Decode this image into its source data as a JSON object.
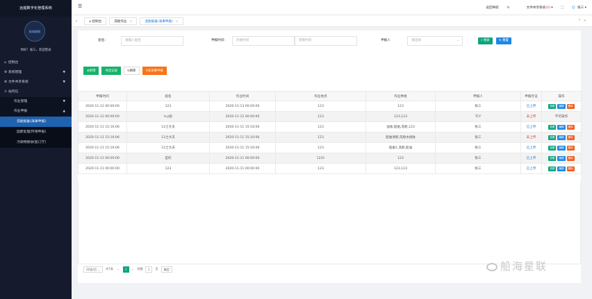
{
  "app": {
    "title": "远船数字化管理系统"
  },
  "sidebar": {
    "avatar_text": "船海星联",
    "greeting": "你好！张三，欢迎登录",
    "items": [
      {
        "label": "控制台",
        "icon": "home-icon"
      },
      {
        "label": "系统管理",
        "icon": "gears-icon"
      },
      {
        "label": "文件共享系统",
        "icon": "gear-icon"
      },
      {
        "label": "站内信",
        "icon": "user-icon"
      },
      {
        "label": "作业管理"
      },
      {
        "label": "作业申报"
      },
      {
        "label": "洗舱报备(海事申报)"
      },
      {
        "label": "固废处理(环保申报)"
      },
      {
        "label": "污染物接收(船订厅)"
      }
    ]
  },
  "topbar": {
    "back_nav": "返回导航",
    "file_share": "文件共享系统",
    "file_share_count": "(0)",
    "user": "张三"
  },
  "tabs": [
    {
      "label": "控制台"
    },
    {
      "label": "洗舱作业"
    },
    {
      "label": "洗舱报备(海事申报)"
    }
  ],
  "search": {
    "ship_label": "船名:",
    "ship_placeholder": "请输入船名",
    "date_label": "申报时间:",
    "start_placeholder": "开始时间",
    "end_placeholder": "结束时间",
    "applicant_label": "申报人",
    "applicant_placeholder": "请选择",
    "search_btn": "搜索",
    "reset_btn": "重置"
  },
  "toolbar": {
    "add": "新增",
    "export": "导出记录",
    "refresh": "刷新",
    "report": "去海事申报"
  },
  "table": {
    "headers": [
      "申报时间",
      "船名",
      "作业时间",
      "作业地点",
      "作业种类",
      "申报人",
      "申报凭证",
      "操作"
    ],
    "rows": [
      {
        "time": "2020-11-12 00:00:00",
        "ship": "123",
        "work_time": "2020-11-13 00:00:00",
        "place": "123",
        "kind": "123",
        "applicant": "张三",
        "status": "已上传",
        "status_type": "up",
        "ops": true
      },
      {
        "time": "2020-11-12 00:00:00",
        "ship": "tcy船",
        "work_time": "2020-11-12 00:00:00",
        "place": "123",
        "kind": "123,123",
        "applicant": "TCY",
        "status": "未上传",
        "status_type": "no",
        "ops": false,
        "ops_text": "不可操作"
      },
      {
        "time": "2020-11-11 15:16:06",
        "ship": "12士大夫",
        "work_time": "2020-11-11 15:16:06",
        "place": "123",
        "kind": "油收,船舶,洗舱,123",
        "applicant": "张三",
        "status": "已上传",
        "status_type": "up",
        "ops": true
      },
      {
        "time": "2020-11-11 15:16:06",
        "ship": "12士大夫",
        "work_time": "2020-11-11 15:16:06",
        "place": "123",
        "kind": "船舶清舱,洗舱水接收",
        "applicant": "张三",
        "status": "未上传",
        "status_type": "no",
        "ops": true
      },
      {
        "time": "2020-11-11 15:16:06",
        "ship": "12士大夫",
        "work_time": "2020-11-11 15:16:06",
        "place": "123",
        "kind": "船舶1,洗舱,船油",
        "applicant": "张三",
        "status": "已上传",
        "status_type": "up",
        "ops": true
      },
      {
        "time": "2020-11-11 00:00:00",
        "ship": "是的",
        "work_time": "2020-11-11 00:00:00",
        "place": "1231",
        "kind": "123",
        "applicant": "张三",
        "status": "已上传",
        "status_type": "up",
        "ops": true
      },
      {
        "time": "2020-11-11 00:00:00",
        "ship": "123",
        "work_time": "2020-11-11 00:00:00",
        "place": "123",
        "kind": "123,123",
        "applicant": "张三",
        "status": "已上传",
        "status_type": "up",
        "ops": true
      }
    ],
    "op_view": "查看",
    "op_edit": "编辑",
    "op_delete": "删除"
  },
  "pager": {
    "page_size": "20条/页",
    "total": "共7条",
    "current": "1",
    "goto": "到第",
    "goto_value": "1",
    "page_unit": "页",
    "confirm": "确定"
  },
  "watermark": "船海星联",
  "colors": {
    "sidebar": "#151b2c",
    "accent": "#1f62ad",
    "green": "#17b26a",
    "orange": "#f97316",
    "red": "#e03a3a",
    "blue": "#1e88e5"
  }
}
